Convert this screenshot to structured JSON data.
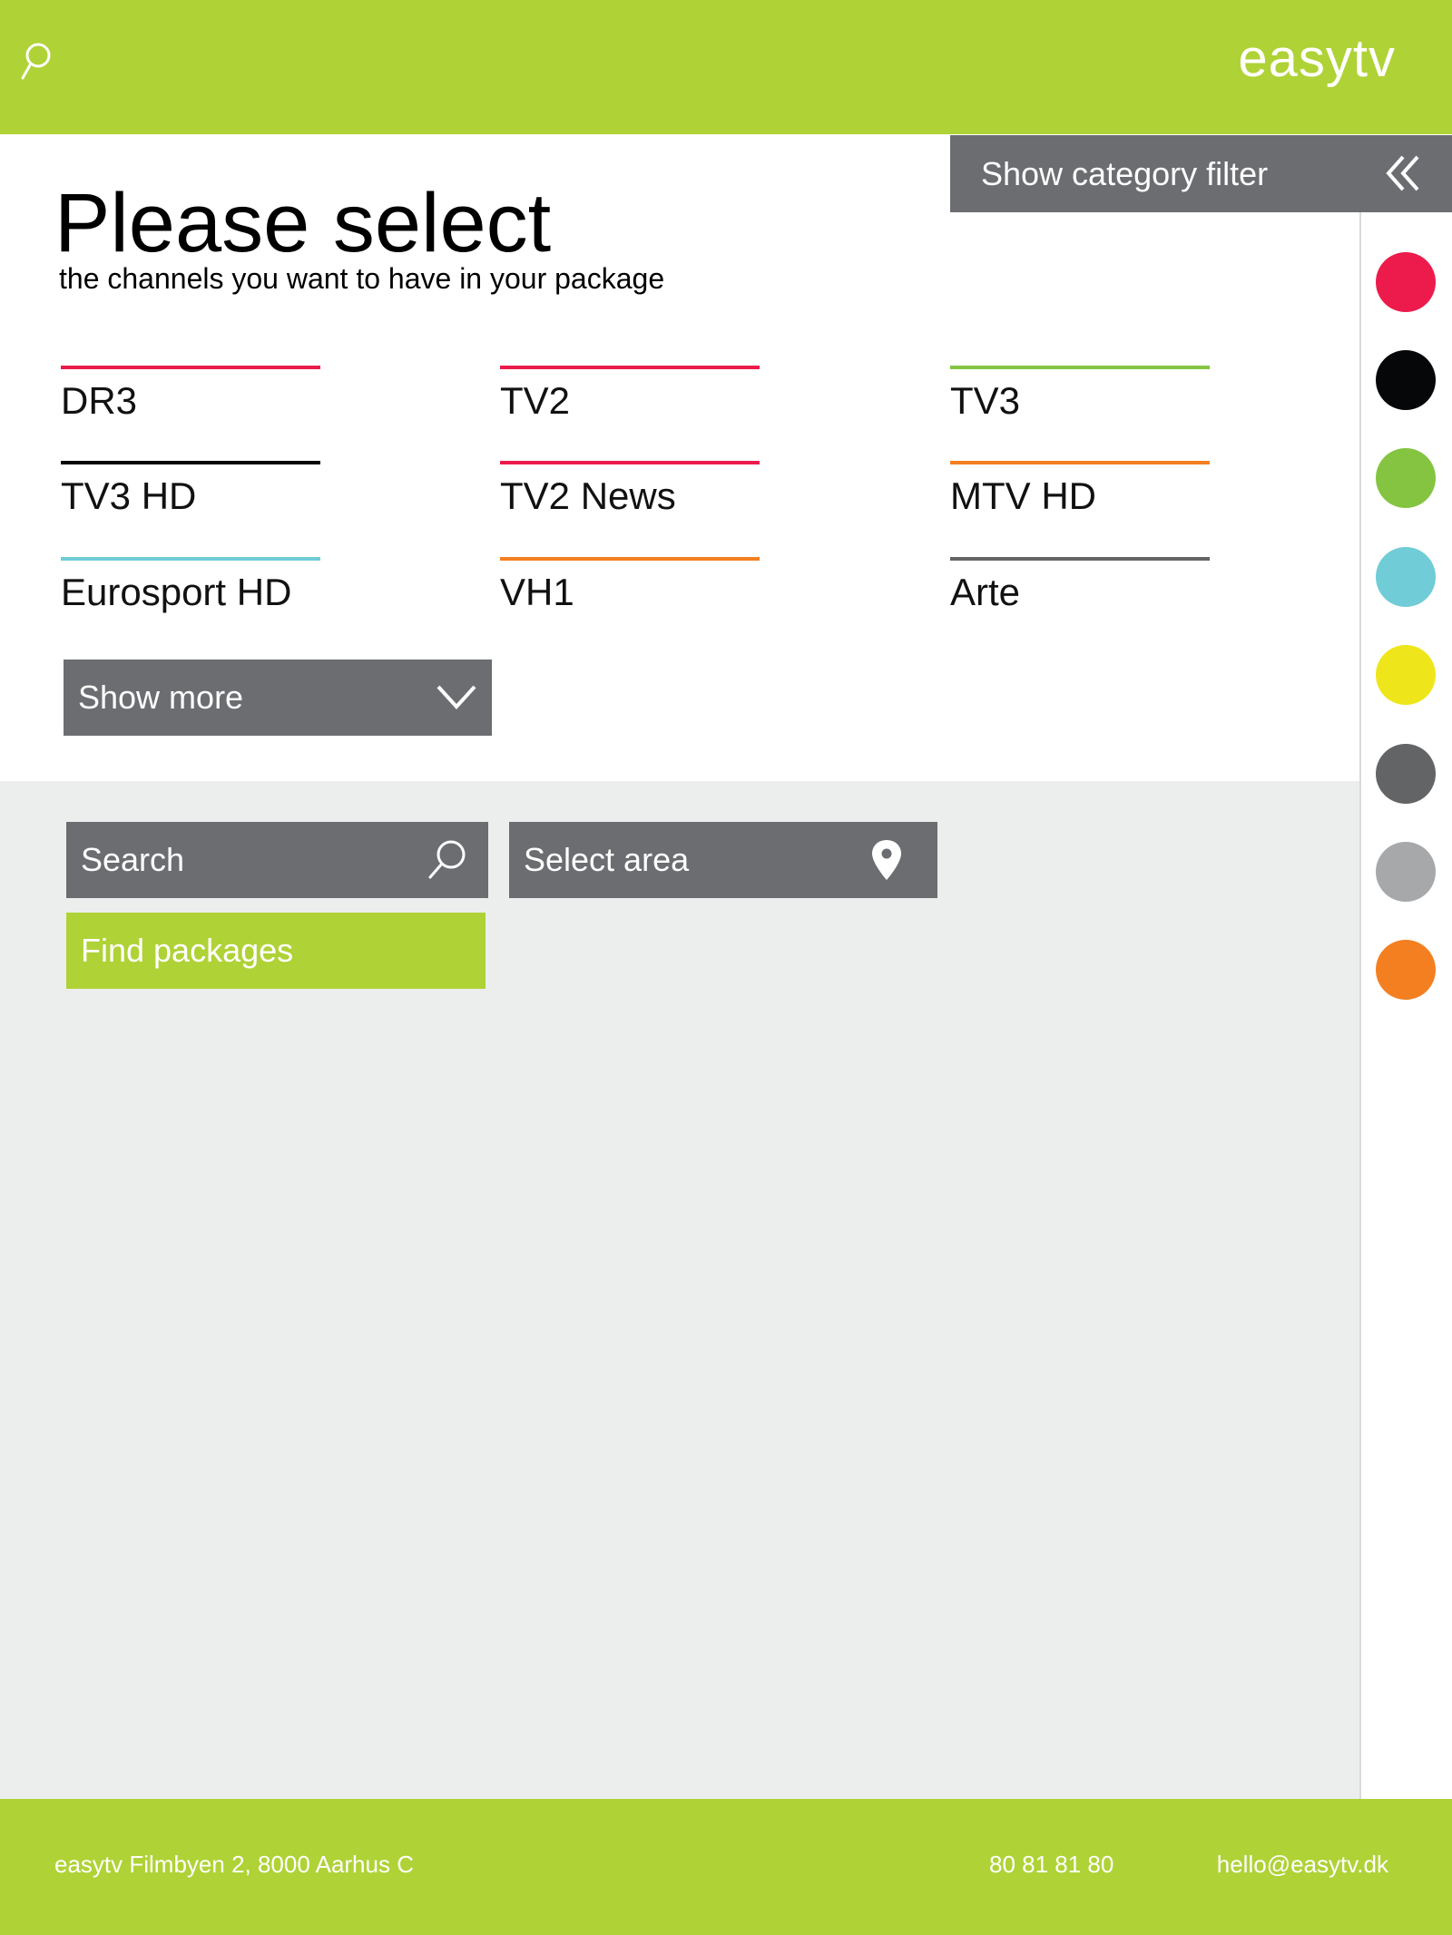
{
  "header": {
    "logo": "easytv",
    "search_icon": "search-icon"
  },
  "category_filter": {
    "label": "Show category filter",
    "icon": "double-chevron-left-icon",
    "colors": [
      {
        "name": "pink",
        "hex": "#ec1b4b"
      },
      {
        "name": "black",
        "hex": "#050709"
      },
      {
        "name": "green",
        "hex": "#84c441"
      },
      {
        "name": "cyan",
        "hex": "#70ccd6"
      },
      {
        "name": "yellow",
        "hex": "#eee61b"
      },
      {
        "name": "dark-gray",
        "hex": "#636466"
      },
      {
        "name": "light-gray",
        "hex": "#a7a8aa"
      },
      {
        "name": "orange",
        "hex": "#f47f20"
      }
    ]
  },
  "main": {
    "title": "Please select",
    "subtitle": "the channels you want to have in your package",
    "channels": [
      {
        "name": "DR3",
        "color": "#ec1b4b"
      },
      {
        "name": "TV2",
        "color": "#ec1b4b"
      },
      {
        "name": "TV3",
        "color": "#84c441"
      },
      {
        "name": "TV3 HD",
        "color": "#050709"
      },
      {
        "name": "TV2 News",
        "color": "#ec1b4b"
      },
      {
        "name": "MTV HD",
        "color": "#f47f20"
      },
      {
        "name": "Eurosport HD",
        "color": "#70ccd6"
      },
      {
        "name": "VH1",
        "color": "#f47f20"
      },
      {
        "name": "Arte",
        "color": "#636466"
      }
    ],
    "show_more": "Show more"
  },
  "search": {
    "search_label": "Search",
    "area_label": "Select area",
    "find_button": "Find packages"
  },
  "footer": {
    "address": "easytv  Filmbyen 2, 8000 Aarhus C",
    "phone": "80 81 81 80",
    "email": "hello@easytv.dk"
  },
  "colors": {
    "brand": "#afd236",
    "control_gray": "#6c6d71",
    "background_gray": "#eceeed"
  }
}
